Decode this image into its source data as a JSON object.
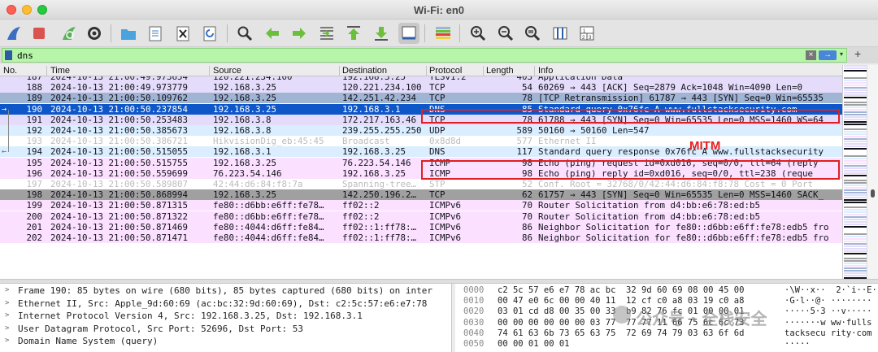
{
  "window": {
    "title": "Wi-Fi: en0"
  },
  "toolbar": {
    "icons": [
      "shark-fin-start-icon",
      "stop-square-icon",
      "restart-fin-icon",
      "gear-icon",
      "folder-icon",
      "save-file-icon",
      "close-file-icon",
      "reload-icon",
      "search-icon",
      "back-arrow-icon",
      "forward-arrow-icon",
      "go-to-packet-icon",
      "first-packet-icon",
      "last-packet-icon",
      "autoscroll-icon",
      "colorize-icon",
      "zoom-in-icon",
      "zoom-out-icon",
      "zoom-reset-icon",
      "resize-columns-icon",
      "layout-icon"
    ]
  },
  "filter": {
    "value": "dns",
    "clear_glyph": "×",
    "apply_glyph": "→",
    "dropdown_glyph": "▾",
    "add_glyph": "+"
  },
  "columns": [
    "No.",
    "Time",
    "Source",
    "Destination",
    "Protocol",
    "Length",
    "Info"
  ],
  "packets": [
    {
      "no": "187",
      "time": "2024-10-13 21:00:49.973654",
      "src": "120.221.234.100",
      "dst": "192.168.3.25",
      "proto": "TLSv1.2",
      "len": "403",
      "info": "Application Data",
      "bg": "#e4dcfa",
      "fg": "#12121a"
    },
    {
      "no": "188",
      "time": "2024-10-13 21:00:49.973779",
      "src": "192.168.3.25",
      "dst": "120.221.234.100",
      "proto": "TCP",
      "len": "54",
      "info": "60269 → 443 [ACK] Seq=2879 Ack=1048 Win=4090 Len=0",
      "bg": "#e4dcfa",
      "fg": "#12121a"
    },
    {
      "no": "189",
      "time": "2024-10-13 21:00:50.109762",
      "src": "192.168.3.25",
      "dst": "142.251.42.234",
      "proto": "TCP",
      "len": "78",
      "info": "[TCP Retransmission] 61787 → 443 [SYN] Seq=0 Win=65535",
      "bg": "#a0b4d4",
      "fg": "#12121a"
    },
    {
      "no": "190",
      "time": "2024-10-13 21:00:50.237854",
      "src": "192.168.3.25",
      "dst": "192.168.3.1",
      "proto": "DNS",
      "len": "85",
      "info": "Standard query 0x76fc A www.fullstacksecurity.com",
      "bg": "#0e57c9",
      "fg": "#ffffff"
    },
    {
      "no": "191",
      "time": "2024-10-13 21:00:50.253483",
      "src": "192.168.3.8",
      "dst": "172.217.163.46",
      "proto": "TCP",
      "len": "78",
      "info": "61788 → 443 [SYN] Seq=0 Win=65535 Len=0 MSS=1460 WS=64",
      "bg": "#e4dcfa",
      "fg": "#12121a"
    },
    {
      "no": "192",
      "time": "2024-10-13 21:00:50.385673",
      "src": "192.168.3.8",
      "dst": "239.255.255.250",
      "proto": "UDP",
      "len": "589",
      "info": "50160 → 50160 Len=547",
      "bg": "#daeeff",
      "fg": "#12121a"
    },
    {
      "no": "193",
      "time": "2024-10-13 21:00:50.386721",
      "src": "HikvisionDig_eb:45:45",
      "dst": "Broadcast",
      "proto": "0x8d8d",
      "len": "577",
      "info": "Ethernet II",
      "bg": "#ffffff",
      "fg": "#bcbcbc"
    },
    {
      "no": "194",
      "time": "2024-10-13 21:00:50.515055",
      "src": "192.168.3.1",
      "dst": "192.168.3.25",
      "proto": "DNS",
      "len": "117",
      "info": "Standard query response 0x76fc A www.fullstacksecurity",
      "bg": "#daeeff",
      "fg": "#12121a"
    },
    {
      "no": "195",
      "time": "2024-10-13 21:00:50.515755",
      "src": "192.168.3.25",
      "dst": "76.223.54.146",
      "proto": "ICMP",
      "len": "98",
      "info": "Echo (ping) request  id=0xd016, seq=0/0, ttl=64 (reply",
      "bg": "#fce0ff",
      "fg": "#12121a"
    },
    {
      "no": "196",
      "time": "2024-10-13 21:00:50.559699",
      "src": "76.223.54.146",
      "dst": "192.168.3.25",
      "proto": "ICMP",
      "len": "98",
      "info": "Echo (ping) reply    id=0xd016, seq=0/0, ttl=238 (reque",
      "bg": "#fce0ff",
      "fg": "#12121a"
    },
    {
      "no": "197",
      "time": "2024-10-13 21:00:50.589807",
      "src": "42:44:d6:84:f8:7a",
      "dst": "Spanning-tree…",
      "proto": "STP",
      "len": "52",
      "info": "Conf. Root = 32768/0/42:44:d6:84:f8:78  Cost = 0  Port",
      "bg": "#ffffff",
      "fg": "#bcbcbc"
    },
    {
      "no": "198",
      "time": "2024-10-13 21:00:50.868994",
      "src": "192.168.3.25",
      "dst": "142.250.196.2…",
      "proto": "TCP",
      "len": "62",
      "info": "61757 → 443 [SYN] Seq=0 Win=65535 Len=0 MSS=1460 SACK_",
      "bg": "#a0a0a0",
      "fg": "#12121a"
    },
    {
      "no": "199",
      "time": "2024-10-13 21:00:50.871315",
      "src": "fe80::d6bb:e6ff:fe78…",
      "dst": "ff02::2",
      "proto": "ICMPv6",
      "len": "70",
      "info": "Router Solicitation from d4:bb:e6:78:ed:b5",
      "bg": "#fce0ff",
      "fg": "#12121a"
    },
    {
      "no": "200",
      "time": "2024-10-13 21:00:50.871322",
      "src": "fe80::d6bb:e6ff:fe78…",
      "dst": "ff02::2",
      "proto": "ICMPv6",
      "len": "70",
      "info": "Router Solicitation from d4:bb:e6:78:ed:b5",
      "bg": "#fce0ff",
      "fg": "#12121a"
    },
    {
      "no": "201",
      "time": "2024-10-13 21:00:50.871469",
      "src": "fe80::4044:d6ff:fe84…",
      "dst": "ff02::1:ff78:…",
      "proto": "ICMPv6",
      "len": "86",
      "info": "Neighbor Solicitation for fe80::d6bb:e6ff:fe78:edb5 fro",
      "bg": "#fce0ff",
      "fg": "#12121a"
    },
    {
      "no": "202",
      "time": "2024-10-13 21:00:50.871471",
      "src": "fe80::4044:d6ff:fe84…",
      "dst": "ff02::1:ff78:…",
      "proto": "ICMPv6",
      "len": "86",
      "info": "Neighbor Solicitation for fe80::d6bb:e6ff:fe78:edb5 fro",
      "bg": "#fce0ff",
      "fg": "#12121a"
    }
  ],
  "annotation": {
    "label": "MITM",
    "color": "#e82020"
  },
  "details": [
    "Frame 190: 85 bytes on wire (680 bits), 85 bytes captured (680 bits) on inter",
    "Ethernet II, Src: Apple_9d:60:69 (ac:bc:32:9d:60:69), Dst: c2:5c:57:e6:e7:78",
    "Internet Protocol Version 4, Src: 192.168.3.25, Dst: 192.168.3.1",
    "User Datagram Protocol, Src Port: 52696, Dst Port: 53",
    "Domain Name System (query)"
  ],
  "hex": [
    {
      "off": "0000",
      "hex": "c2 5c 57 e6 e7 78 ac bc  32 9d 60 69 08 00 45 00",
      "ascii": "·\\W··x··  2·`i··E·"
    },
    {
      "off": "0010",
      "hex": "00 47 e0 6c 00 00 40 11  12 cf c0 a8 03 19 c0 a8",
      "ascii": "·G·l··@· ········"
    },
    {
      "off": "0020",
      "hex": "03 01 cd d8 00 35 00 33  b9 82 76 fc 01 00 00 01",
      "ascii": "·····5·3 ··v·····"
    },
    {
      "off": "0030",
      "hex": "00 00 00 00 00 00 03 77  77 77 11 66 75 6c 6c 73",
      "ascii": "·······w ww·fulls"
    },
    {
      "off": "0040",
      "hex": "74 61 63 6b 73 65 63 75  72 69 74 79 03 63 6f 6d",
      "ascii": "tacksecu rity·com"
    },
    {
      "off": "0050",
      "hex": "00 00 01 00 01",
      "ascii": "·····"
    }
  ],
  "watermark": {
    "text": "公众号 · 全栈安全"
  }
}
